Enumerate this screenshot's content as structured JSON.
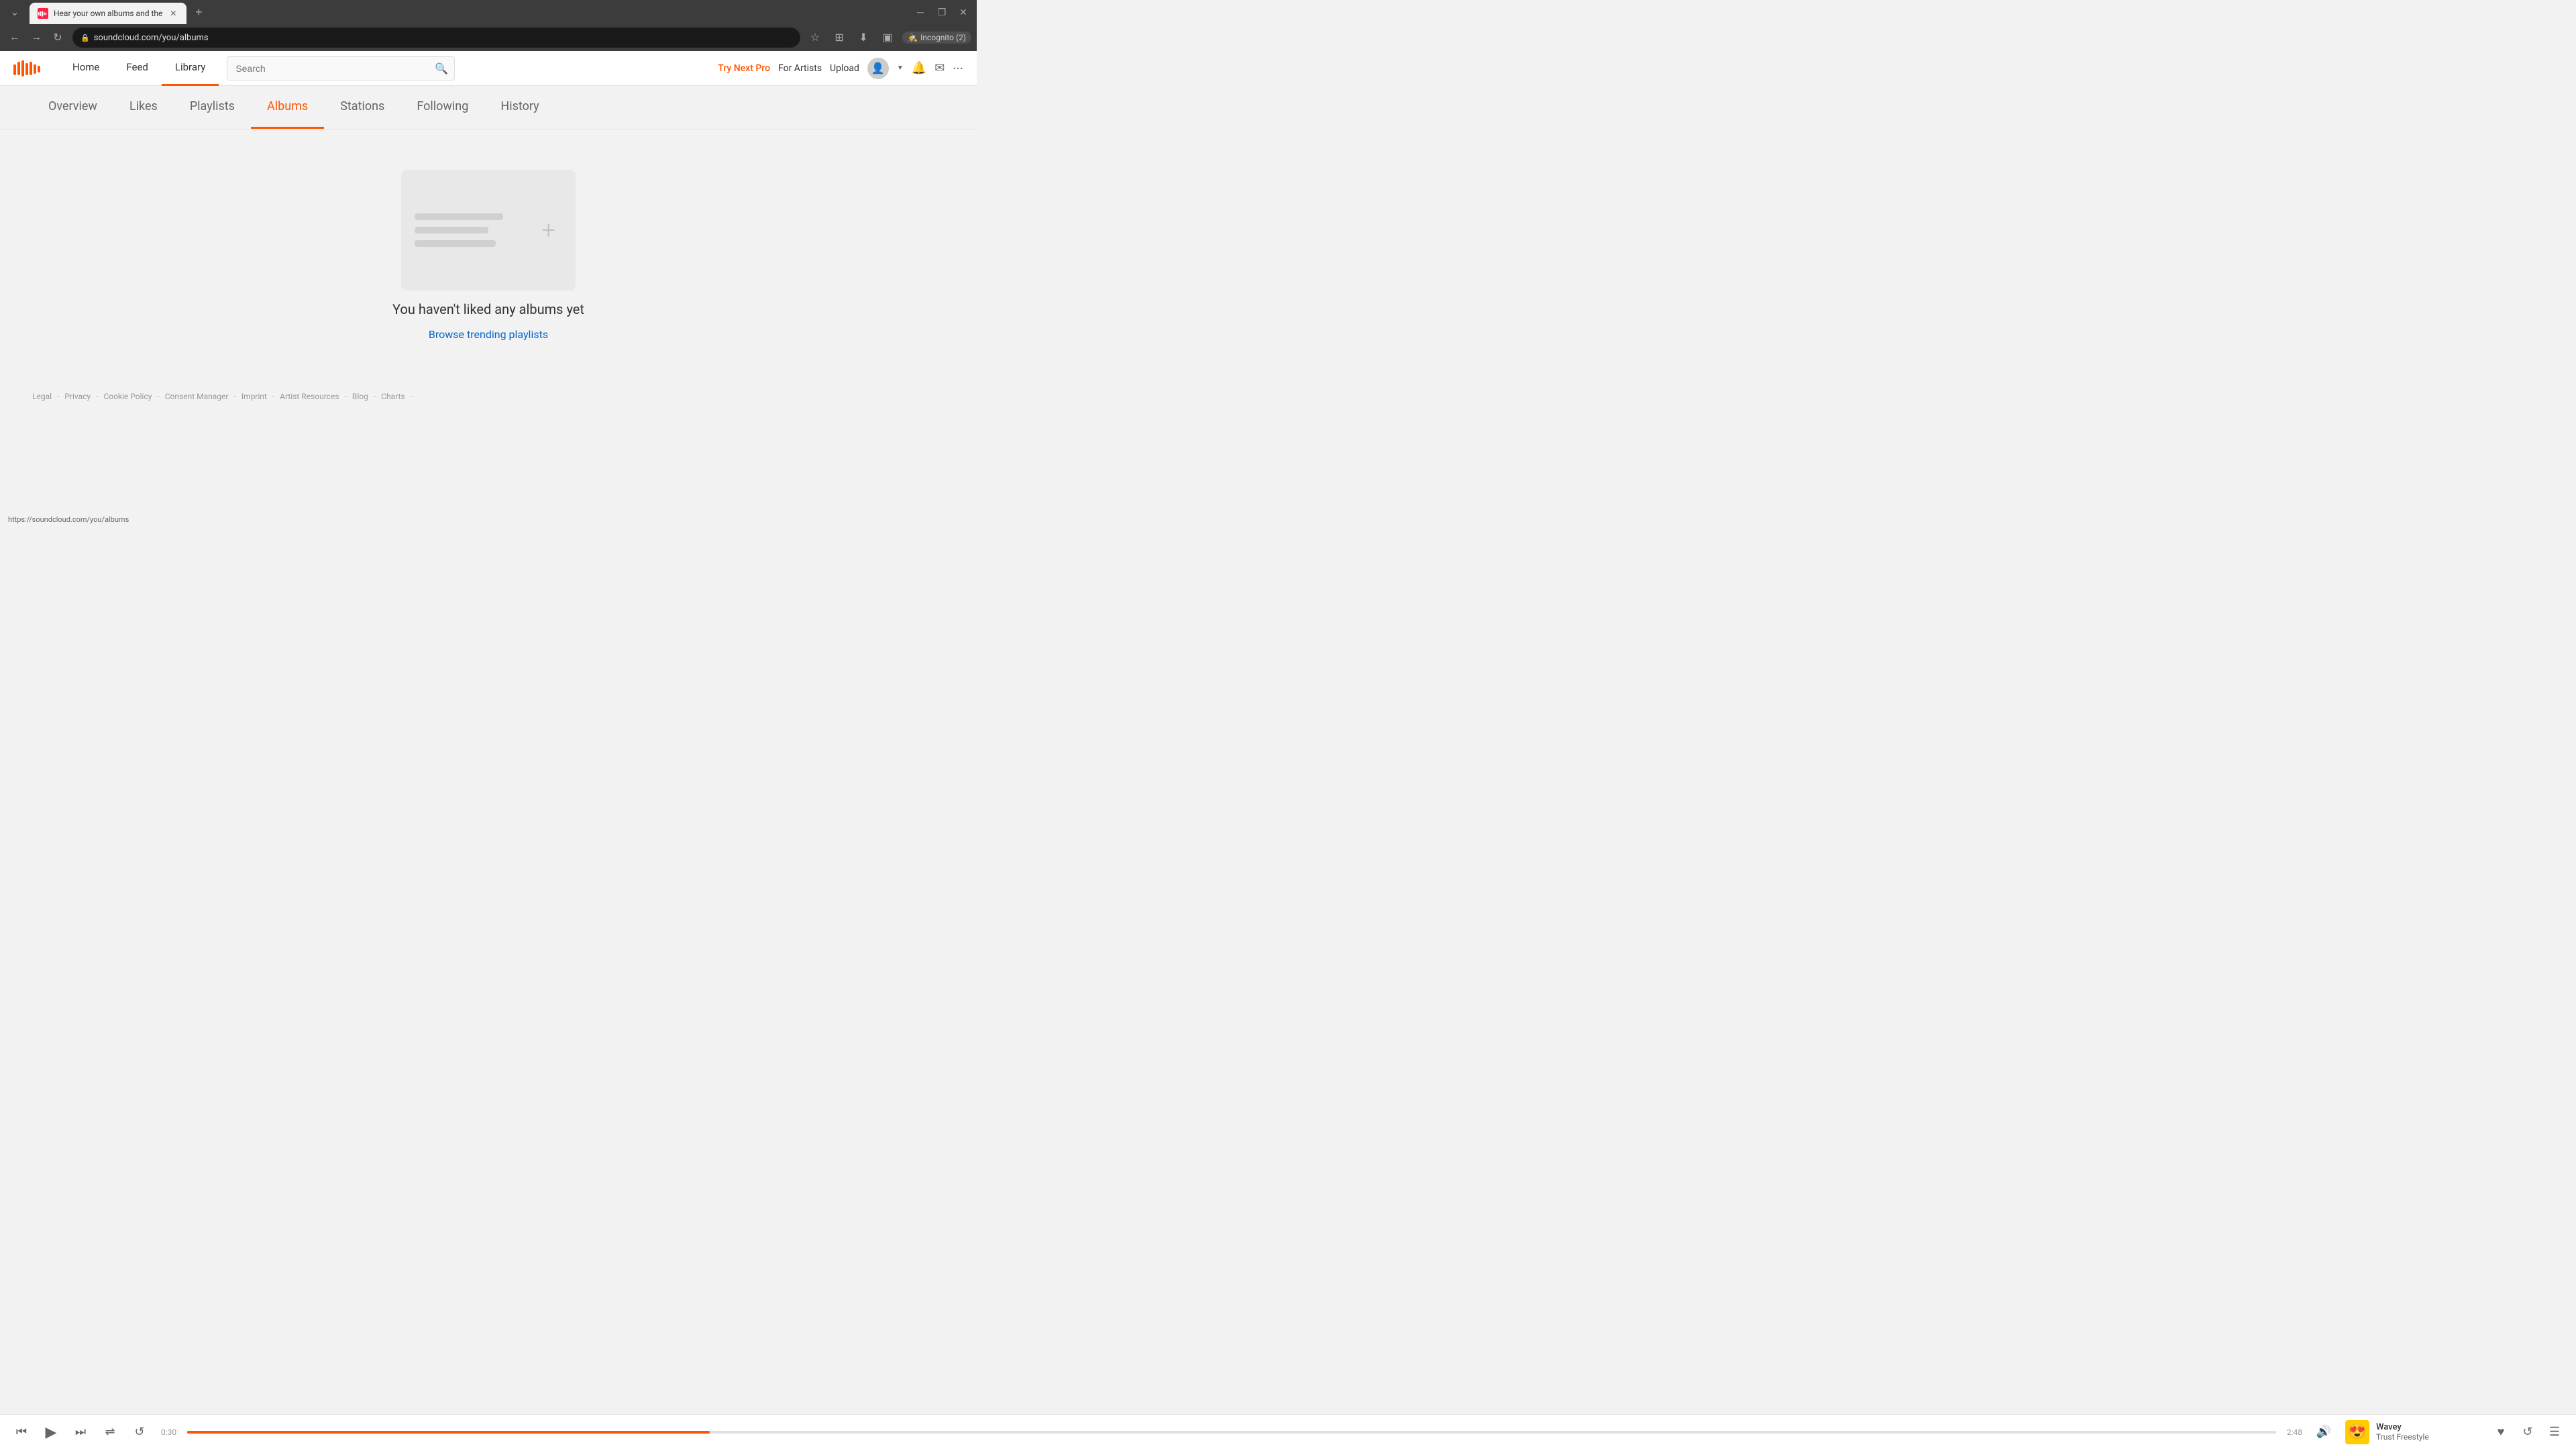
{
  "browser": {
    "tab_title": "Hear your own albums and the",
    "tab_favicon": "SC",
    "url": "soundcloud.com/you/albums",
    "incognito_label": "Incognito (2)",
    "new_tab_label": "+"
  },
  "header": {
    "nav": {
      "home": "Home",
      "feed": "Feed",
      "library": "Library"
    },
    "search_placeholder": "Search",
    "try_next_pro": "Try Next Pro",
    "for_artists": "For Artists",
    "upload": "Upload"
  },
  "library": {
    "tabs": [
      {
        "id": "overview",
        "label": "Overview"
      },
      {
        "id": "likes",
        "label": "Likes"
      },
      {
        "id": "playlists",
        "label": "Playlists"
      },
      {
        "id": "albums",
        "label": "Albums"
      },
      {
        "id": "stations",
        "label": "Stations"
      },
      {
        "id": "following",
        "label": "Following"
      },
      {
        "id": "history",
        "label": "History"
      }
    ],
    "active_tab": "albums"
  },
  "empty_state": {
    "title": "You haven't liked any albums yet",
    "link_text": "Browse trending playlists"
  },
  "footer": {
    "links": [
      {
        "label": "Legal"
      },
      {
        "label": "Privacy"
      },
      {
        "label": "Cookie Policy"
      },
      {
        "label": "Consent Manager"
      },
      {
        "label": "Imprint"
      },
      {
        "label": "Artist Resources"
      },
      {
        "label": "Blog"
      },
      {
        "label": "Charts"
      }
    ]
  },
  "player": {
    "track_name": "Wavey",
    "track_artist": "Trust Freestyle",
    "time_elapsed": "0:30",
    "time_remaining": "2:48",
    "progress_percent": 25
  },
  "status_bar": {
    "url": "https://soundcloud.com/you/albums"
  }
}
